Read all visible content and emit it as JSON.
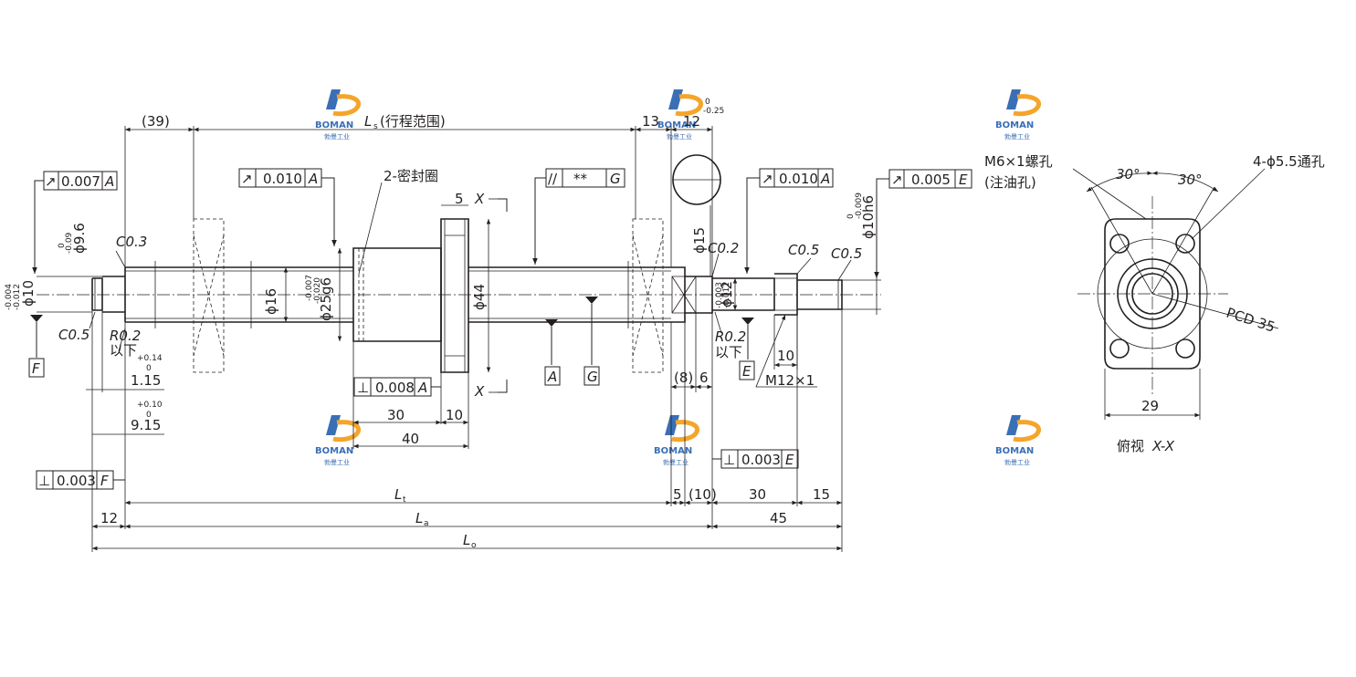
{
  "logo": {
    "text": "BOMAN",
    "subtext": "勃曼工业"
  },
  "tolerance_frames": {
    "runout_left": {
      "symbol": "↗",
      "value": "0.007",
      "datum": "A"
    },
    "runout_nut": {
      "symbol": "↗",
      "value": "0.010",
      "datum": "A"
    },
    "parallel_nut": {
      "symbol": "//",
      "value": "**",
      "datum": "G"
    },
    "runout_right": {
      "symbol": "↗",
      "value": "0.010",
      "datum": "A"
    },
    "runout_end": {
      "symbol": "↗",
      "value": "0.005",
      "datum": "E"
    },
    "perp_flange": {
      "symbol": "⊥",
      "value": "0.008",
      "datum": "A"
    },
    "perp_left": {
      "symbol": "⊥",
      "value": "0.003",
      "datum": "F"
    },
    "perp_right": {
      "symbol": "⊥",
      "value": "0.003",
      "datum": "E"
    }
  },
  "datums": {
    "A": "A",
    "G": "G",
    "F": "F",
    "E": "E"
  },
  "labels": {
    "seal": "2-密封圈",
    "ls": "L",
    "ls_sub": "s",
    "ls_note": "(行程范围)",
    "section_mark": "X",
    "view_caption": "俯视",
    "view_caption_it": "X-X",
    "oil_hole_1": "M6×1螺孔",
    "oil_hole_2": "(注油孔)",
    "through_hole": "4-ϕ5.5通孔",
    "pcd": "PCD 35",
    "thread": "M12×1",
    "r02_left": "R0.2",
    "r02_left_note": "以下",
    "r02_right": "R0.2",
    "r02_right_note": "以下"
  },
  "dimensions": {
    "d39": "(39)",
    "d13": "13",
    "d12_top": "12",
    "d12_top_tol_up": "0",
    "d12_top_tol_lo": "-0.25",
    "d5": "5",
    "d15": "ϕ15",
    "d30a": "30",
    "d10a": "10",
    "d40": "40",
    "d8": "(8)",
    "d6": "6",
    "d10b": "10",
    "lt": "L",
    "lt_sub": "t",
    "d5b": "5",
    "d10c": "(10)",
    "d30b": "30",
    "d15b": "15",
    "d12": "12",
    "la": "L",
    "la_sub": "a",
    "d45": "45",
    "lo": "L",
    "lo_sub": "o",
    "d115": "1.15",
    "d115_up": "+0.14",
    "d115_lo": "0",
    "d915": "9.15",
    "d915_up": "+0.10",
    "d915_lo": "0",
    "d29": "29",
    "ang1": "30°",
    "ang2": "30°",
    "c03": "C0.3",
    "c05_left": "C0.5",
    "c02": "C0.2",
    "c05_r1": "C0.5",
    "c05_r2": "C0.5",
    "phi96": "ϕ9.6",
    "phi96_up": "0",
    "phi96_lo": "-0.09",
    "phi10": "ϕ10",
    "phi10_up": "-0.004",
    "phi10_lo": "-0.012",
    "phi16": "ϕ16",
    "phi25": "ϕ25g6",
    "phi25_up": "-0.007",
    "phi25_lo": "-0.020",
    "phi44": "ϕ44",
    "phi12": "ϕ12",
    "phi12_up": "-0.003",
    "phi12_lo": "-0.011",
    "phi10h6": "ϕ10h6",
    "phi10h6_up": "0",
    "phi10h6_lo": "-0.009"
  }
}
